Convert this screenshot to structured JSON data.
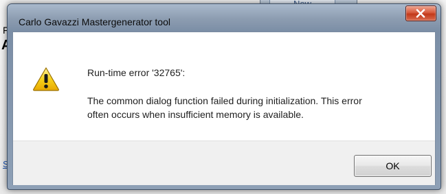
{
  "background": {
    "new_button_label": "New",
    "fragment_f": "F",
    "fragment_a": "A",
    "fragment_s": "S"
  },
  "dialog": {
    "title": "Carlo Gavazzi Mastergenerator tool",
    "heading": "Run-time error '32765':",
    "message": "The common dialog function failed during initialization. This error\noften occurs when insufficient memory is available.",
    "ok_label": "OK",
    "icon": "warning-icon",
    "close_icon": "close-icon"
  },
  "colors": {
    "close_button": "#c7452a",
    "warning_yellow": "#f5c400",
    "title_bar": "#8c9cb0"
  }
}
